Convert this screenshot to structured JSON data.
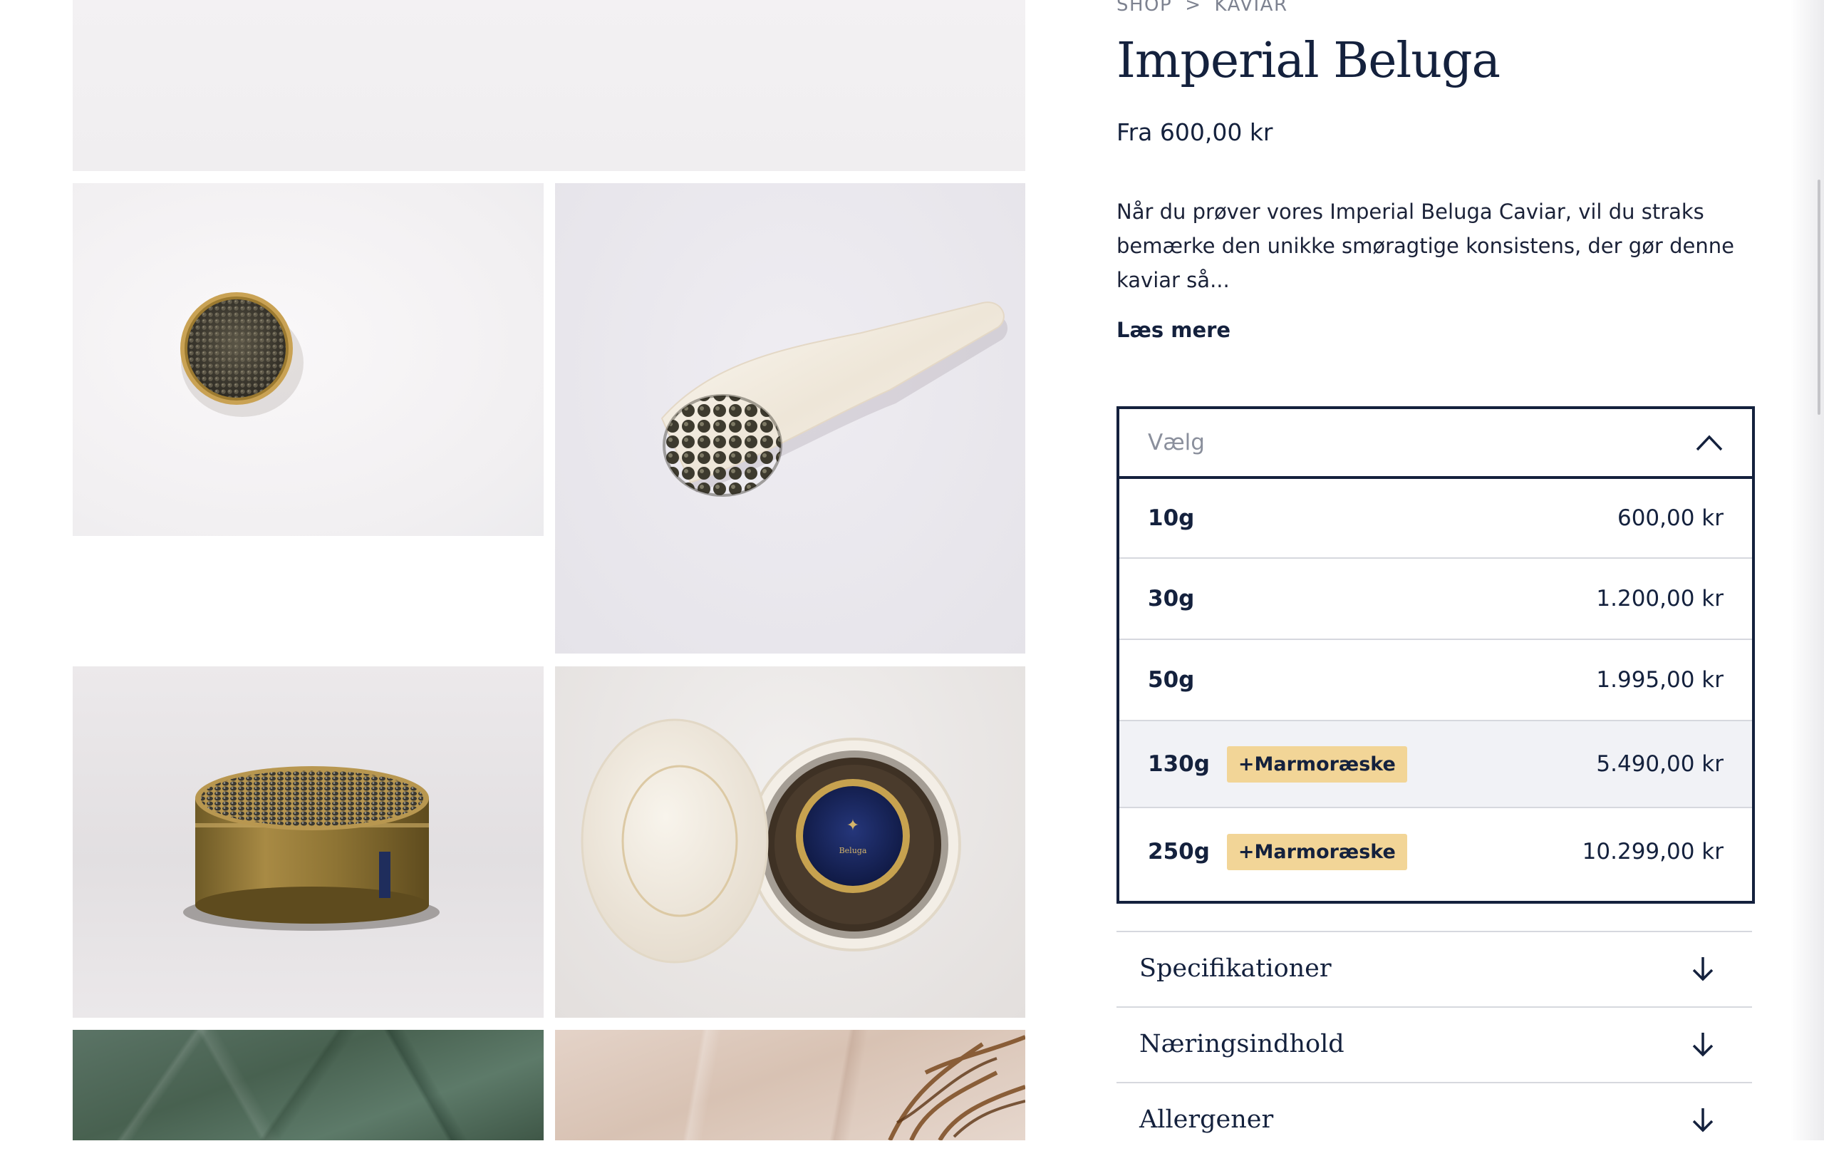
{
  "breadcrumb": {
    "shop": "SHOP",
    "separator": ">",
    "category": "KAVIAR"
  },
  "product": {
    "title": "Imperial Beluga",
    "price_from": "Fra 600,00 kr",
    "description": "Når du prøver vores Imperial Beluga Caviar, vil du straks bemærke den unikke smøragtige konsistens, der gør denne kaviar så...",
    "read_more": "Læs mere"
  },
  "variant_select": {
    "placeholder": "Vælg",
    "state": "expanded",
    "options": [
      {
        "weight": "10g",
        "badge": "",
        "price": "600,00 kr"
      },
      {
        "weight": "30g",
        "badge": "",
        "price": "1.200,00 kr"
      },
      {
        "weight": "50g",
        "badge": "",
        "price": "1.995,00 kr"
      },
      {
        "weight": "130g",
        "badge": "+Marmoræske",
        "price": "5.490,00 kr"
      },
      {
        "weight": "250g",
        "badge": "+Marmoræske",
        "price": "10.299,00 kr"
      }
    ]
  },
  "accordions": [
    {
      "label": "Specifikationer"
    },
    {
      "label": "Næringsindhold"
    },
    {
      "label": "Allergener"
    }
  ],
  "brand_label": {
    "line1": "Beluga"
  },
  "colors": {
    "navy": "#14213d",
    "badge": "#f2d597",
    "gold": "#b08a3a",
    "highlight_row": "#f1f2f6"
  },
  "icons": {
    "select_toggle": "chevron-up-icon",
    "accordion_toggle": "arrow-down-icon"
  }
}
